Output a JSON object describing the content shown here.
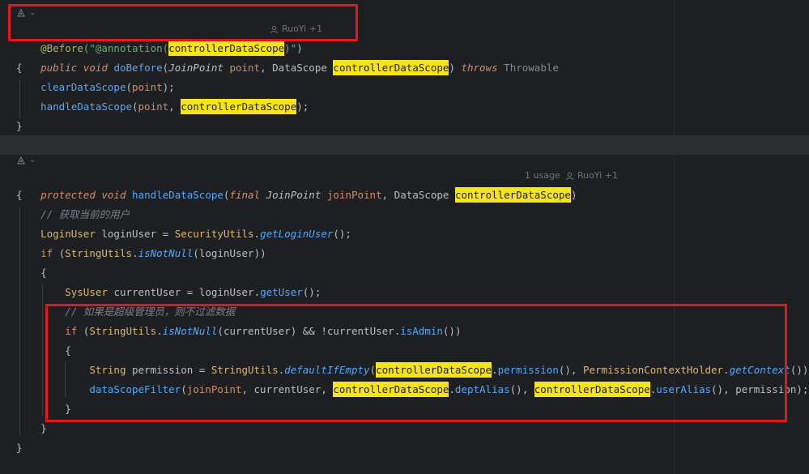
{
  "code": {
    "l1_annotation": "@Before",
    "l1_paren_open": "(\"",
    "l1_string_a": "@annotation(",
    "l1_highlight": "controllerDataScope",
    "l1_string_b": ")\"",
    "l1_paren_close": ")",
    "l1_author": "RuoYi +1",
    "l2_public": "public",
    "l2_void": "void",
    "l2_method": "doBefore",
    "l2_type1": "JoinPoint",
    "l2_param1": "point",
    "l2_type2": "DataScope",
    "l2_param2": "controllerDataScope",
    "l2_throws": "throws",
    "l2_throwable": "Throwable",
    "l3_brace": "{",
    "l4_call": "clearDataScope",
    "l4_arg": "point",
    "l5_call": "handleDataScope",
    "l5_arg1": "point",
    "l5_arg2": "controllerDataScope",
    "l6_brace": "}",
    "m_author": "RuoYi +1",
    "m_usage": "1 usage",
    "m_protected": "protected",
    "m_void": "void",
    "m_method": "handleDataScope",
    "m_final": "final",
    "m_type1": "JoinPoint",
    "m_param1": "joinPoint",
    "m_type2": "DataScope",
    "m_param2": "controllerDataScope",
    "m_open": "{",
    "c1_comment": "// 获取当前的用户",
    "c2_type": "LoginUser",
    "c2_var": "loginUser",
    "c2_cls": "SecurityUtils",
    "c2_call": "getLoginUser",
    "c3_if": "if",
    "c3_cls": "StringUtils",
    "c3_call": "isNotNull",
    "c3_arg": "loginUser",
    "c4_open": "{",
    "c5_type": "SysUser",
    "c5_var": "currentUser",
    "c5_obj": "loginUser",
    "c5_call": "getUser",
    "c6_comment": "// 如果是超级管理员，则不过滤数据",
    "c7_if": "if",
    "c7_cls": "StringUtils",
    "c7_call": "isNotNull",
    "c7_arg": "currentUser",
    "c7_obj": "currentUser",
    "c7_call2": "isAdmin",
    "c8_open": "{",
    "c9_type": "String",
    "c9_var": "permission",
    "c9_cls": "StringUtils",
    "c9_call": "defaultIfEmpty",
    "c9_hl": "controllerDataScope",
    "c9_call2": "permission",
    "c9_cls2": "PermissionContextHolder",
    "c9_call3": "getContext",
    "c10_call": "dataScopeFilter",
    "c10_arg1": "joinPoint",
    "c10_arg2": "currentUser",
    "c10_hl1": "controllerDataScope",
    "c10_call2": "deptAlias",
    "c10_hl2": "controllerDataScope",
    "c10_call3": "userAlias",
    "c10_arg3": "permission",
    "c11_close": "}",
    "c12_close": "}",
    "m_close": "}"
  },
  "colors": {
    "background": "#1e1f22",
    "keyword": "#cf8e6d",
    "function": "#56a8f5",
    "string": "#6aab73",
    "annotation": "#b3ae60",
    "highlight": "#f6e414",
    "comment": "#7a7e85",
    "annotation_box": "#e0171c"
  }
}
